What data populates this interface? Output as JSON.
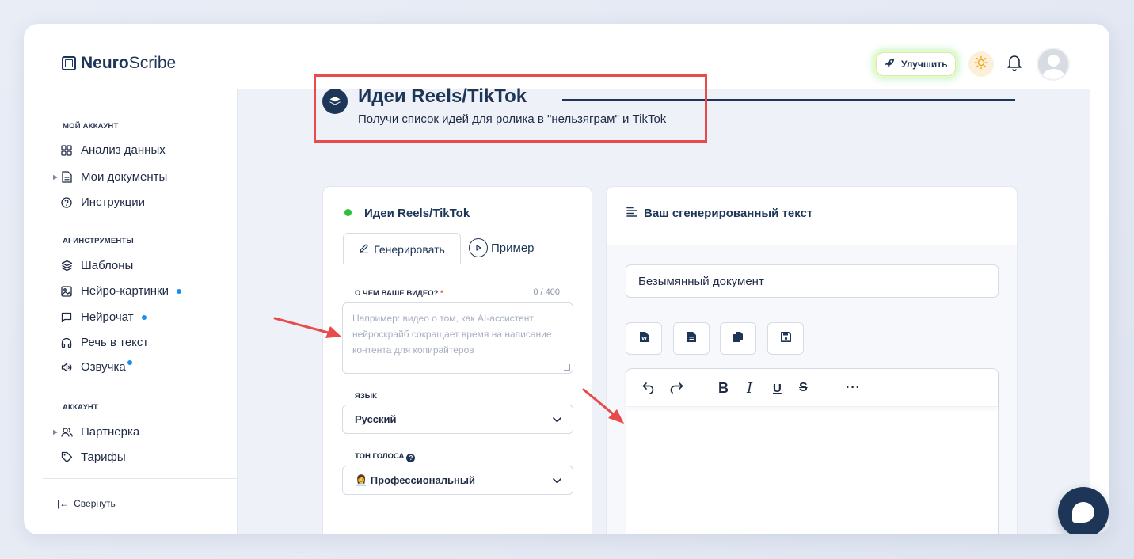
{
  "app": {
    "logo_bold": "Neuro",
    "logo_light": "Scribe"
  },
  "header": {
    "upgrade_label": "Улучшить",
    "icons": [
      "rocket-icon",
      "sun-icon",
      "bell-icon",
      "avatar"
    ]
  },
  "sidebar": {
    "sections": [
      {
        "label": "МОЙ АККАУНТ"
      },
      {
        "label": "AI-ИНСТРУМЕНТЫ"
      },
      {
        "label": "АККАУНТ"
      }
    ],
    "items": [
      {
        "label": "Анализ данных",
        "icon": "grid-icon"
      },
      {
        "label": "Мои документы",
        "icon": "document-icon",
        "expandable": true
      },
      {
        "label": "Инструкции",
        "icon": "help-circle-icon"
      },
      {
        "label": "Шаблоны",
        "icon": "layers-icon"
      },
      {
        "label": "Нейро-картинки",
        "icon": "image-icon",
        "new_dot": true
      },
      {
        "label": "Нейрочат",
        "icon": "chat-icon",
        "new_dot": true
      },
      {
        "label": "Речь в текст",
        "icon": "headphones-icon"
      },
      {
        "label": "Озвучка",
        "icon": "speaker-icon",
        "new_dot": true
      },
      {
        "label": "Партнерка",
        "icon": "users-icon",
        "expandable": true
      },
      {
        "label": "Тарифы",
        "icon": "tag-icon"
      }
    ],
    "collapse_label": "Свернуть"
  },
  "page": {
    "title": "Идеи Reels/TikTok",
    "subtitle": "Получи список идей для ролика в \"нельзяграм\" и TikTok"
  },
  "form": {
    "card_title": "Идеи Reels/TikTok",
    "tabs": [
      "Генерировать",
      "Пример"
    ],
    "active_tab": "Генерировать",
    "topic_label": "О ЧЕМ ВАШЕ ВИДЕО?",
    "topic_required": "*",
    "topic_counter": "0 / 400",
    "topic_placeholder": "Например: видео о том, как AI-ассистент нейроскрайб сокращает время на написание контента для копирайтеров",
    "language_label": "ЯЗЫК",
    "language_value": "Русский",
    "tone_label": "ТОН ГОЛОСА",
    "tone_value": "👩‍💼 Профессиональный"
  },
  "output": {
    "card_title": "Ваш сгенерированный текст",
    "document_name": "Безымянный документ",
    "action_buttons": [
      "word-export-icon",
      "file-icon",
      "copy-icon",
      "save-icon"
    ],
    "toolbar": [
      "undo-icon",
      "redo-icon",
      "bold-icon",
      "italic-icon",
      "underline-icon",
      "strikethrough-icon",
      "more-icon"
    ]
  },
  "colors": {
    "primary": "#1d3557",
    "highlight_box": "#e84b4b",
    "arrow": "#e84b4b",
    "status_green": "#2fbf3a",
    "new_dot": "#1b8cf0"
  }
}
